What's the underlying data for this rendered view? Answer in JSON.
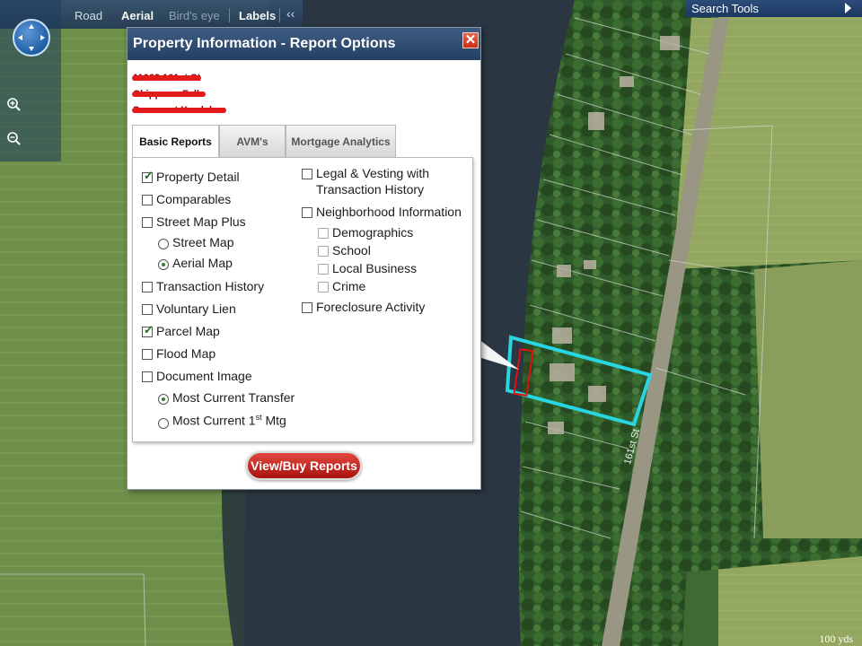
{
  "toolbar": {
    "road": "Road",
    "aerial": "Aerial",
    "birds_eye": "Bird's eye",
    "labels": "Labels",
    "collapse": "‹‹"
  },
  "nav": {
    "compass_icon": "pan-compass-icon",
    "zoom_in_icon": "zoom-in-icon",
    "zoom_out_icon": "zoom-out-icon"
  },
  "search_tools": {
    "label": "Search Tools"
  },
  "dialog": {
    "title": "Property Information - Report Options",
    "close_label": "✕",
    "address_lines": [
      "11062 161st St",
      "Chippewa Falls",
      "Somerset Kurdahor"
    ],
    "tabs": [
      {
        "label": "Basic Reports",
        "active": true
      },
      {
        "label": "AVM's",
        "active": false
      },
      {
        "label": "Mortgage Analytics",
        "active": false
      }
    ],
    "left_options": {
      "property_detail": "Property Detail",
      "comparables": "Comparables",
      "street_map_plus": "Street Map Plus",
      "street_map": "Street Map",
      "aerial_map": "Aerial Map",
      "transaction_history": "Transaction History",
      "voluntary_lien": "Voluntary Lien",
      "parcel_map": "Parcel Map",
      "flood_map": "Flood Map",
      "document_image": "Document Image",
      "most_current_transfer": "Most Current Transfer",
      "most_current_mtg_prefix": "Most Current 1",
      "most_current_mtg_sup": "st",
      "most_current_mtg_suffix": " Mtg"
    },
    "right_options": {
      "legal_vesting_line1": "Legal & Vesting with",
      "legal_vesting_line2": "Transaction History",
      "neighborhood_info": "Neighborhood Information",
      "demographics": "Demographics",
      "school": "School",
      "local_business": "Local Business",
      "crime": "Crime",
      "foreclosure_activity": "Foreclosure Activity"
    },
    "checked": {
      "property_detail": true,
      "parcel_map": true,
      "comparables": false,
      "street_map_plus": false,
      "transaction_history": false,
      "voluntary_lien": false,
      "flood_map": false,
      "document_image": false,
      "legal_vesting": false,
      "neighborhood_info": false,
      "foreclosure_activity": false
    },
    "radios": {
      "street_map_plus": "aerial_map",
      "document_image": "most_current_transfer"
    },
    "buy_button": "View/Buy Reports"
  },
  "map": {
    "street_label": "161st St",
    "scale": "100 yds"
  },
  "colors": {
    "title_bar": "#2f4d73",
    "buy_button": "#c62a22",
    "parcel_outline": "#27d6e0",
    "parcel_marker": "#e01010"
  }
}
